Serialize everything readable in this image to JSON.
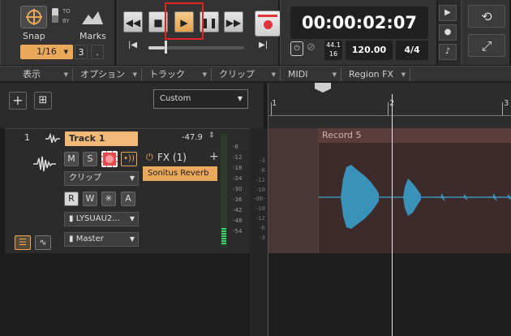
{
  "control_bar": {
    "snap": {
      "label": "Snap",
      "to_by_top": "TO",
      "to_by_bottom": "BY",
      "marks_label": "Marks",
      "value": "1/16",
      "count": "3",
      "dot": "."
    },
    "transport": {
      "rewind_icon": "rewind-icon",
      "stop_icon": "stop-icon",
      "play_icon": "play-icon",
      "pause_icon": "pause-icon",
      "ffwd_icon": "fast-forward-icon",
      "record_icon": "record-icon",
      "position_fraction": 0.17
    },
    "time": {
      "display": "00:00:02:07",
      "sample_rate_top": "44.1",
      "sample_rate_bottom": "16",
      "tempo": "120.00",
      "meter": "4/4"
    }
  },
  "menu": {
    "items": [
      "表示",
      "オプション",
      "トラック",
      "クリップ",
      "MIDI",
      "Region FX"
    ]
  },
  "track_toolbar": {
    "view_preset": "Custom"
  },
  "track": {
    "number": "1",
    "name": "Track 1",
    "volume": "-47.9",
    "mute_label": "M",
    "solo_label": "S",
    "read_label": "R",
    "write_label": "W",
    "auto_label": "A",
    "edit_filter": "クリップ",
    "input": "LYSUAU2...",
    "output": "Master",
    "fx_title": "FX (1)",
    "fx_slot": "Sonitus Reverb",
    "meter_scale": [
      "-6",
      "-12",
      "-18",
      "-24",
      "-30",
      "-36",
      "-42",
      "-48",
      "-54"
    ]
  },
  "timeline": {
    "ruler_labels": [
      "1",
      "2",
      "3"
    ],
    "scale_labels": [
      "-3",
      "-6",
      "-12",
      "-18",
      "-dB-",
      "-18",
      "-12",
      "-6",
      "-3"
    ],
    "clip_name": "Record 5"
  }
}
